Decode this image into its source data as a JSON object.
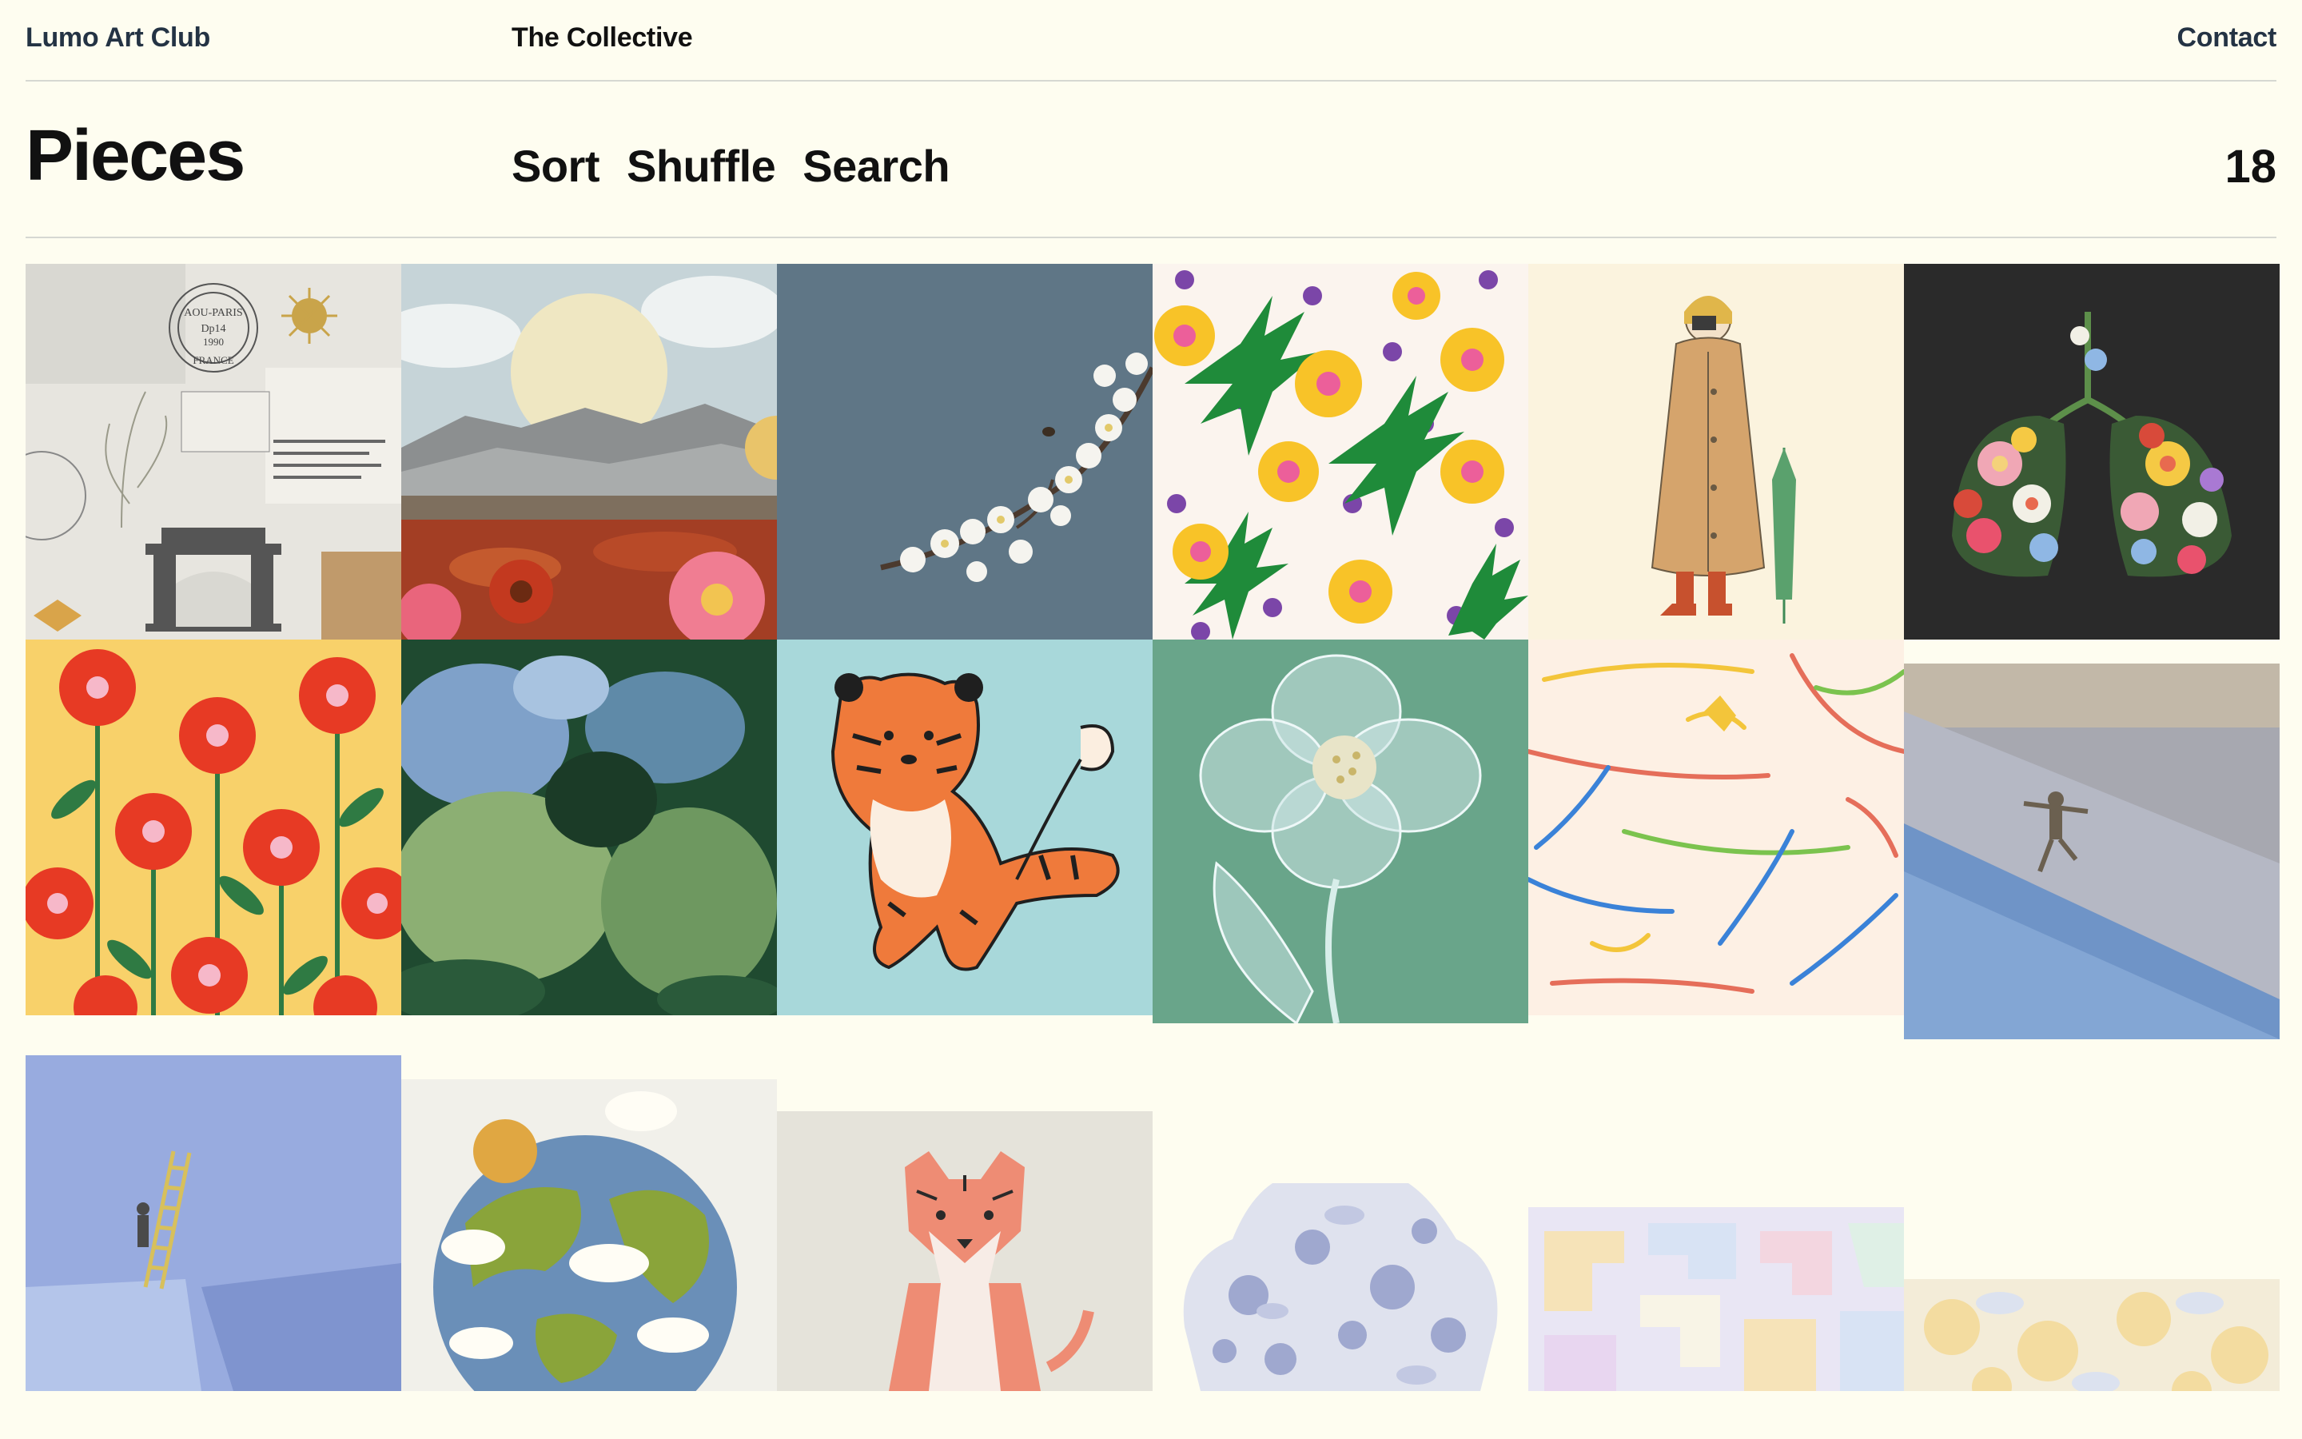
{
  "site": {
    "brand": "Lumo Art Club",
    "section": "The Collective",
    "contact": "Contact"
  },
  "header": {
    "title": "Pieces",
    "actions": [
      "Sort",
      "Shuffle",
      "Search"
    ],
    "count": "18"
  },
  "pieces": [
    {
      "subject": "paris-collage",
      "stamp_text": "AOU-PARIS Dp14 1990 FRANCE"
    },
    {
      "subject": "landscape-sun-collage"
    },
    {
      "subject": "cherry-blossom-branch"
    },
    {
      "subject": "flower-leaf-pattern"
    },
    {
      "subject": "girl-in-coat"
    },
    {
      "subject": "floral-lungs"
    },
    {
      "subject": "red-flowers-pattern"
    },
    {
      "subject": "green-foliage"
    },
    {
      "subject": "tiger-cartoon"
    },
    {
      "subject": "glass-flower"
    },
    {
      "subject": "colorful-strokes"
    },
    {
      "subject": "jumping-figure"
    },
    {
      "subject": "ladder-figure"
    },
    {
      "subject": "fuzzy-earth"
    },
    {
      "subject": "tiger-geometric"
    },
    {
      "subject": "blue-floral-vase"
    },
    {
      "subject": "pastel-puzzle"
    },
    {
      "subject": "yellow-floral-pattern"
    }
  ],
  "colors": {
    "background": "#fefdf0",
    "text": "#111111",
    "brand_text": "#243344",
    "divider": "#d6d8d2"
  }
}
